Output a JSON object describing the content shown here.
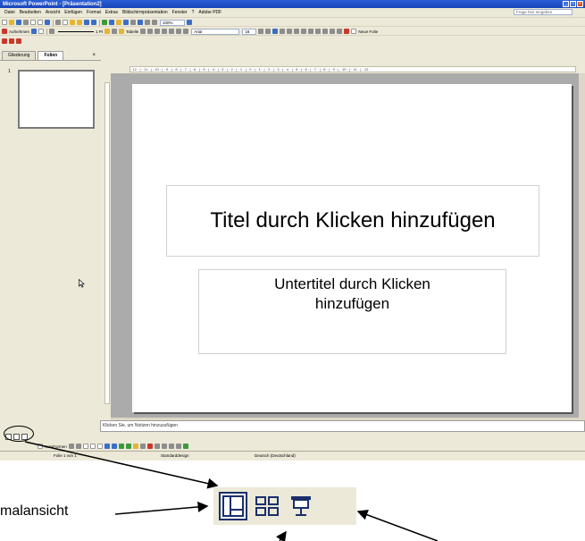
{
  "window": {
    "title": "Microsoft PowerPoint - [Präsentation2]",
    "controls": [
      "_",
      "□",
      "×"
    ]
  },
  "menu": {
    "items": [
      "Datei",
      "Bearbeiten",
      "Ansicht",
      "Einfügen",
      "Format",
      "Extras",
      "Bildschirmpräsentation",
      "Fenster",
      "?",
      "Adobe PDF"
    ],
    "help_placeholder": "Frage hier eingeben"
  },
  "toolbar": {
    "zoom": "100%",
    "record_label": "Aufnehmen",
    "line_weight": "1 Pt",
    "table_label": "Tabelle",
    "font_name": "Arial",
    "font_size": "18",
    "new_slide_label": "Neue Folie"
  },
  "left_panel": {
    "tab_outline": "Gliederung",
    "tab_slides": "Folien",
    "close_glyph": "×",
    "slide_number": "1"
  },
  "ruler": {
    "ticks": "· 12 · | · 11 · | · 10 · | · 9 · | · 8 · | · 7 · | · 6 · | · 5 · | · 4 · | · 3 · | · 2 · | · 1 · | · 0 · | · 1 · | · 2 · | · 3 · | · 4 · | · 5 · | · 6 · | · 7 · | · 8 · | · 9 · | · 10 · | · 11 · | · 12 ·"
  },
  "slide": {
    "title_placeholder": "Titel durch Klicken hinzufügen",
    "subtitle_placeholder": "Untertitel durch Klicken hinzufügen"
  },
  "notes": {
    "placeholder": "Klicken Sie, um Notizen hinzuzufügen"
  },
  "drawing_toolbar": {
    "autoshapes_label": "AutoFormen"
  },
  "status_bar": {
    "slide_info": "Folie 1 von 1",
    "design": "Standarddesign",
    "language": "Deutsch (Deutschland)"
  },
  "callout": {
    "label": "malansicht"
  },
  "colors": {
    "titlebar": "#2a5fd8",
    "chrome": "#ece9d8",
    "workspace": "#ababab",
    "selected_view_border": "#1a2f6b"
  },
  "icons": [
    "normal-view-icon",
    "slide-sorter-icon",
    "slideshow-icon",
    "pointer-cursor-icon"
  ]
}
